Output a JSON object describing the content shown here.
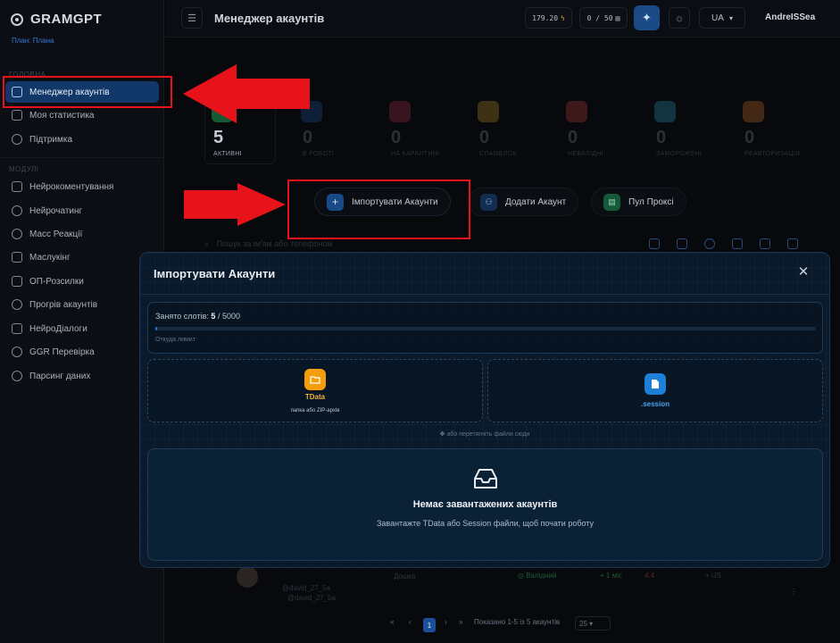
{
  "app": {
    "logo_text": "GRAMGPT",
    "plan": "План: Плана"
  },
  "sidebar": {
    "section_main": "ГОЛОВНА",
    "section_modules": "МОДУЛІ",
    "main_items": [
      {
        "label": "Менеджер акаунтів",
        "icon": "grid-icon",
        "active": true
      },
      {
        "label": "Моя статистика",
        "icon": "chart-icon"
      },
      {
        "label": "Підтримка",
        "icon": "globe-icon"
      }
    ],
    "module_items": [
      {
        "label": "Нейрокоментування",
        "icon": "comments-icon"
      },
      {
        "label": "Нейрочатинг",
        "icon": "chat-icon"
      },
      {
        "label": "Масс Реакції",
        "icon": "smile-icon"
      },
      {
        "label": "Маслукінг",
        "icon": "monitor-icon"
      },
      {
        "label": "ОП-Розсилки",
        "icon": "send-icon"
      },
      {
        "label": "Прогрів акаунтів",
        "icon": "flame-icon"
      },
      {
        "label": "НейроДіалоги",
        "icon": "dialog-icon"
      },
      {
        "label": "GGR Перевірка",
        "icon": "gear-icon"
      },
      {
        "label": "Парсинг даних",
        "icon": "database-icon"
      }
    ]
  },
  "header": {
    "title": "Менеджер акаунтів",
    "balance": "179.20",
    "balance_icon": "bolt-icon",
    "slots_counter": "0 / 50",
    "language": "UA",
    "username": "AndreISSea"
  },
  "stats": [
    {
      "value": "5",
      "label": "АКТИВНІ",
      "color": "#1f9d55"
    },
    {
      "value": "0",
      "label": "В РОБОТІ",
      "color": "#1f5fa8"
    },
    {
      "value": "0",
      "label": "НА КАРАНТИНІ",
      "color": "#b8344f"
    },
    {
      "value": "0",
      "label": "СПАМБЛОК",
      "color": "#c9a227"
    },
    {
      "value": "0",
      "label": "НЕВАЛІДНІ",
      "color": "#c9463d"
    },
    {
      "value": "0",
      "label": "ЗАМОРОЖЕНІ",
      "color": "#2aa7c4"
    },
    {
      "value": "0",
      "label": "РЕАВТОРИЗАЦІЯ",
      "color": "#e07a2a"
    }
  ],
  "actions": {
    "import": "Імпортувати Акаунти",
    "add": "Додати Акаунт",
    "proxy": "Пул Проксі"
  },
  "search": {
    "placeholder": "Пошук за ім'ям або телефоном"
  },
  "table_row": {
    "username_1": "@david_27_5a",
    "username_2": "@david_27_5a",
    "status_1": "Дошка",
    "status_2": "Валідний",
    "age": "1 міс",
    "score": "4.4",
    "region": "US"
  },
  "pagination": {
    "current_page": "1",
    "summary": "Показано 1-5 із 5 акаунтів",
    "page_size": "25"
  },
  "modal": {
    "title": "Імпортувати Акаунти",
    "slots_label": "Занято слотів:",
    "slots_used": "5",
    "slots_total": "/ 5000",
    "slots_fraction": 0.001,
    "slots_hint": "Откуда лимит",
    "tdata_title": "TData",
    "tdata_sub": "папка або ZIP-архів",
    "session_title": ".session",
    "drag_hint": "або перетягніть файли сюди",
    "empty_title": "Немає завантажених акаунтів",
    "empty_sub": "Завантажте TData або Session файли, щоб почати роботу"
  },
  "colors": {
    "accent_blue": "#12386a",
    "annotation_red": "#e8121a",
    "tdata_orange": "#f59e0b",
    "session_blue": "#1d7fd6"
  }
}
